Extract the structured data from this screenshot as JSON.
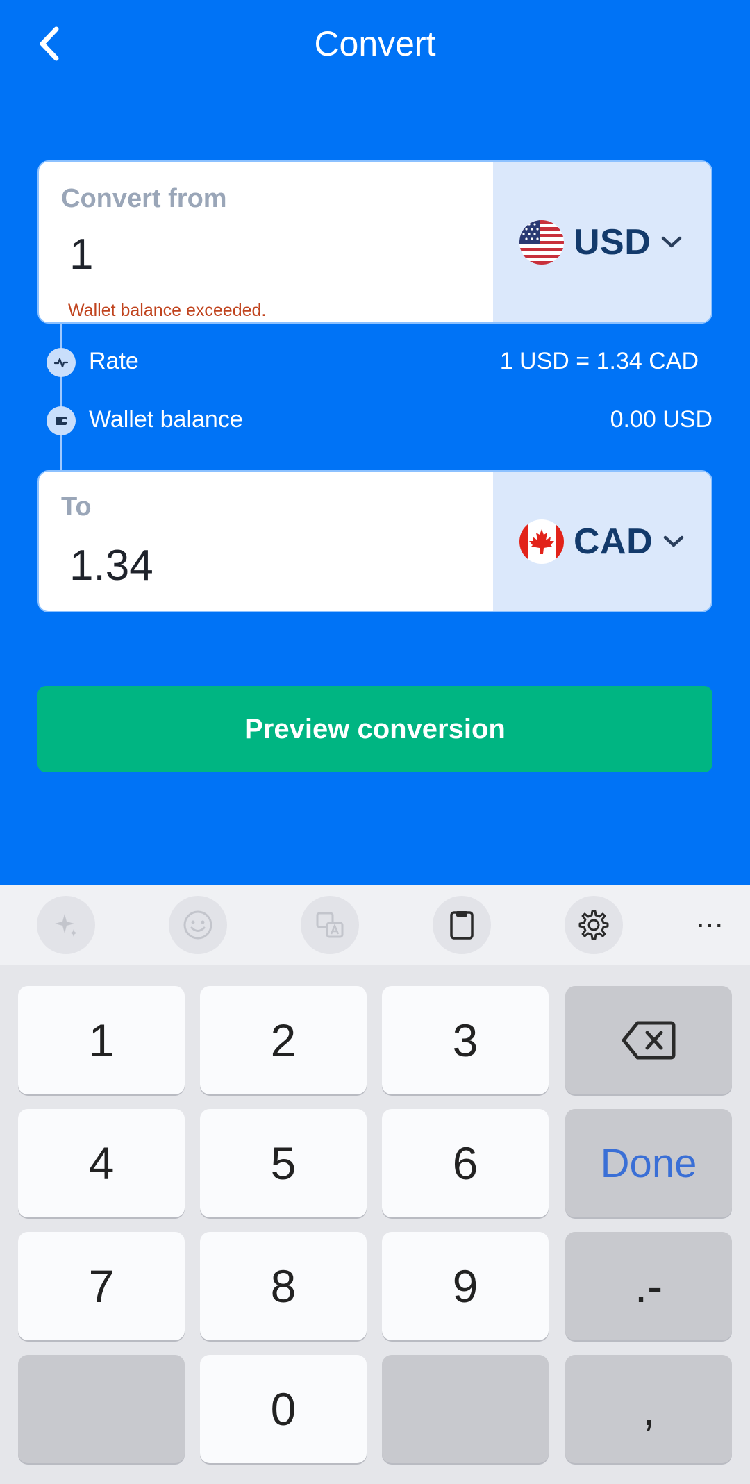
{
  "header": {
    "title": "Convert"
  },
  "from_card": {
    "label": "Convert from",
    "value": "1",
    "error": "Wallet balance exceeded.",
    "currency": "USD"
  },
  "info": {
    "rate_label": "Rate",
    "rate_value": "1 USD = 1.34 CAD",
    "balance_label": "Wallet balance",
    "balance_value": "0.00 USD"
  },
  "to_card": {
    "label": "To",
    "value": "1.34",
    "currency": "CAD"
  },
  "preview_button": "Preview conversion",
  "keyboard": {
    "toolbar_icons": [
      "sparkle-icon",
      "emoji-icon",
      "translate-icon",
      "clipboard-icon",
      "gear-icon",
      "more-icon"
    ],
    "more_label": "⋯",
    "keys": {
      "k1": "1",
      "k2": "2",
      "k3": "3",
      "k4": "4",
      "k5": "5",
      "k6": "6",
      "k7": "7",
      "k8": "8",
      "k9": "9",
      "k0": "0",
      "done": "Done",
      "dot_minus": ".-",
      "comma": ","
    }
  },
  "colors": {
    "background": "#0073f6",
    "primary_button": "#00b582",
    "error": "#c0431d",
    "currency_panel": "#dbe8fb",
    "currency_text": "#133a6b"
  }
}
